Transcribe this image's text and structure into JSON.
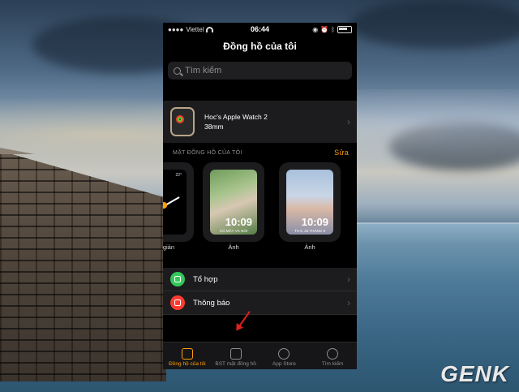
{
  "status": {
    "carrier": "Viettel",
    "time": "06:44"
  },
  "nav": {
    "title": "Đồng hồ của tôi"
  },
  "search": {
    "placeholder": "Tìm kiếm"
  },
  "watch": {
    "name": "Hoc's Apple Watch 2",
    "size": "38mm"
  },
  "faces_section": {
    "header": "MẶT ĐỒNG HỒ CỦA TÔI",
    "edit": "Sửa",
    "faces": [
      {
        "label": "giản",
        "number": "22°"
      },
      {
        "label": "Ảnh",
        "time": "10:09",
        "date": "CÓ MÂY VÀ NÓI"
      },
      {
        "label": "Ảnh",
        "time": "10:09",
        "date": "TH 6, 23 THÁNG 9"
      }
    ]
  },
  "list": [
    {
      "label": "Tổ hợp",
      "icon": "complications-icon",
      "color": "#34c759"
    },
    {
      "label": "Thông báo",
      "icon": "notifications-icon",
      "color": "#ff3b30"
    }
  ],
  "tabs": [
    {
      "label": "Đồng hồ của tôi",
      "icon": "my-watch-icon",
      "active": true
    },
    {
      "label": "BST mặt đồng hồ",
      "icon": "face-gallery-icon",
      "active": false
    },
    {
      "label": "App Store",
      "icon": "app-store-icon",
      "active": false
    },
    {
      "label": "Tìm kiếm",
      "icon": "search-icon",
      "active": false
    }
  ],
  "watermark": "GENK",
  "colors": {
    "accent": "#ff9f0a",
    "annotation_arrow": "#e0201f"
  }
}
